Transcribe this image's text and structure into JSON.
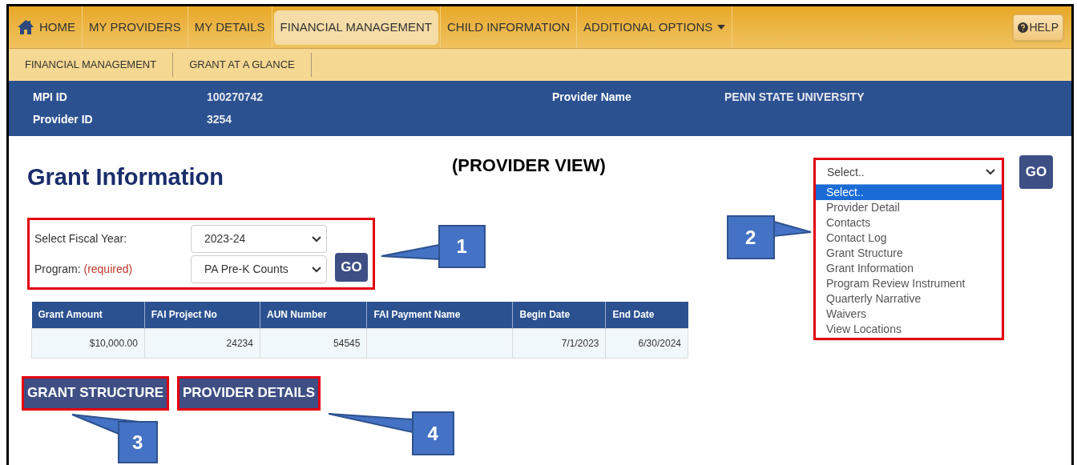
{
  "nav": {
    "items": [
      {
        "label": "HOME",
        "kind": "home",
        "selected": false
      },
      {
        "label": "MY PROVIDERS",
        "kind": "plain",
        "selected": false
      },
      {
        "label": "MY DETAILS",
        "kind": "plain",
        "selected": false
      },
      {
        "label": "FINANCIAL MANAGEMENT",
        "kind": "plain",
        "selected": true
      },
      {
        "label": "CHILD INFORMATION",
        "kind": "plain",
        "selected": false
      },
      {
        "label": "ADDITIONAL OPTIONS",
        "kind": "menu",
        "selected": false
      }
    ],
    "help": "HELP"
  },
  "subnav": [
    "FINANCIAL MANAGEMENT",
    "GRANT AT A GLANCE"
  ],
  "provider_info": [
    {
      "label": "MPI ID",
      "value": "100270742"
    },
    {
      "label": "Provider Name",
      "value": "PENN STATE UNIVERSITY"
    },
    {
      "label": "Provider ID",
      "value": "3254"
    }
  ],
  "page_title": "Grant Information",
  "view_label": "(PROVIDER VIEW)",
  "filters": [
    {
      "label": "Select Fiscal Year:",
      "value": "2023-24"
    },
    {
      "label": "Program:",
      "note": "(required)",
      "value": "PA Pre-K Counts"
    }
  ],
  "filter_go": "GO",
  "table": {
    "columns": [
      "Grant Amount",
      "FAI Project No",
      "AUN Number",
      "FAI Payment Name",
      "Begin Date",
      "End Date"
    ],
    "rows": [
      [
        "$10,000.00",
        "24234",
        "54545",
        "",
        "7/1/2023",
        "6/30/2024"
      ]
    ]
  },
  "buttons": [
    "GRANT STRUCTURE",
    "PROVIDER DETAILS"
  ],
  "page_select": {
    "value": "Select..",
    "go": "GO",
    "options": [
      {
        "label": "Select..",
        "selected": true
      },
      {
        "label": "Provider Detail",
        "selected": false
      },
      {
        "label": "Contacts",
        "selected": false
      },
      {
        "label": "Contact Log",
        "selected": false
      },
      {
        "label": "Grant Structure",
        "selected": false
      },
      {
        "label": "Grant Information",
        "selected": false
      },
      {
        "label": "Program Review Instrument",
        "selected": false
      },
      {
        "label": "Quarterly Narrative",
        "selected": false
      },
      {
        "label": "Waivers",
        "selected": false
      },
      {
        "label": "View Locations",
        "selected": false
      }
    ]
  },
  "annotations": [
    "1",
    "2",
    "3",
    "4"
  ]
}
